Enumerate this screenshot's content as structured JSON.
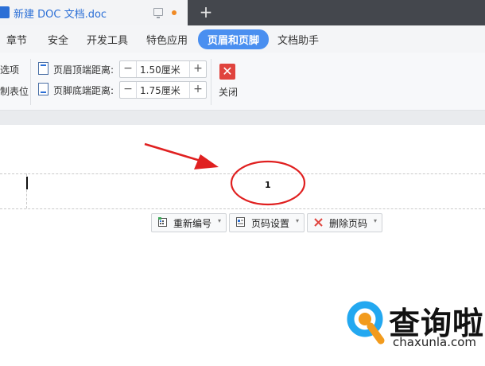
{
  "tab": {
    "title": "新建 DOC 文档.doc",
    "new_tab_label": "+"
  },
  "menu": {
    "items": [
      "章节",
      "安全",
      "开发工具",
      "特色应用",
      "页眉和页脚",
      "文档助手"
    ],
    "active_item": "页眉和页脚"
  },
  "toolbar": {
    "left_labels": [
      "选项",
      "制表位"
    ],
    "header_distance": {
      "label": "页眉顶端距离:",
      "value": "1.50厘米"
    },
    "footer_distance": {
      "label": "页脚底端距离:",
      "value": "1.75厘米"
    },
    "minus": "−",
    "plus": "+",
    "close": {
      "icon_glyph": "✕",
      "label": "关闭"
    }
  },
  "page": {
    "page_number": "1",
    "buttons": [
      {
        "label": "重新编号",
        "icon": "renumber-icon"
      },
      {
        "label": "页码设置",
        "icon": "page-number-settings-icon"
      },
      {
        "label": "删除页码",
        "icon": "delete-icon"
      }
    ],
    "caret": "▾"
  },
  "watermark": {
    "text": "查询啦",
    "url": "chaxunla.com"
  },
  "colors": {
    "accent": "#4a8ff0",
    "annotation_red": "#e02020",
    "close_red": "#e0443e",
    "brand_blue": "#2b6fd6"
  }
}
